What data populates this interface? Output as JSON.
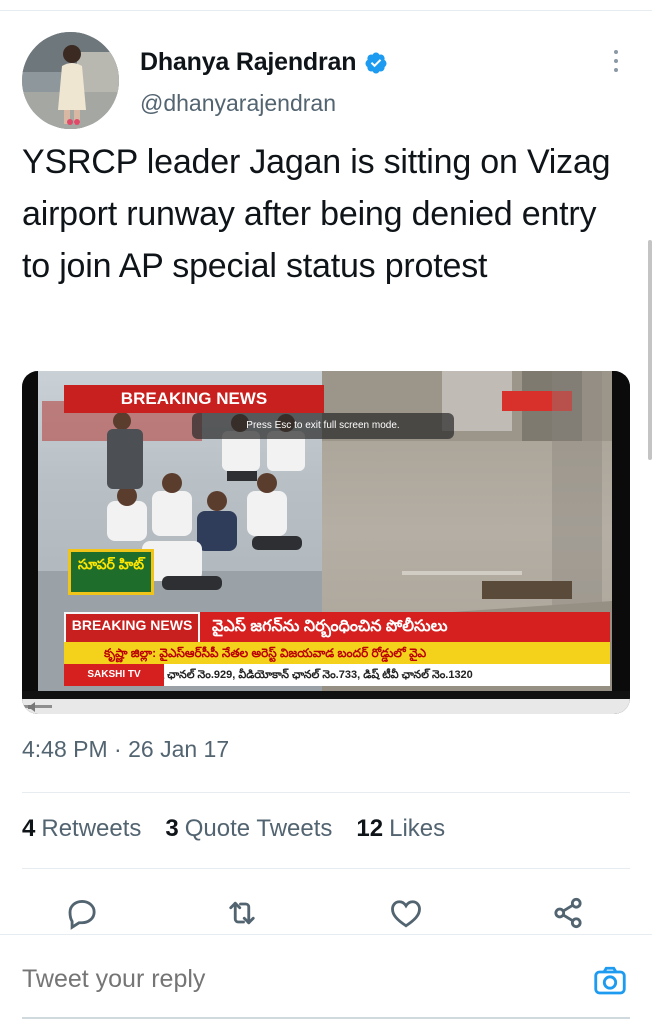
{
  "author": {
    "name": "Dhanya Rajendran",
    "handle": "@dhanyarajendran",
    "verified": true
  },
  "tweet": {
    "text": "YSRCP leader Jagan is sitting on Vizag airport runway after being denied entry to join AP special status protest",
    "timestamp": "4:48 PM · 26 Jan 17"
  },
  "media": {
    "breaking_top": "BREAKING NEWS",
    "esc_message": "Press Esc to exit full screen mode.",
    "super_hit": "సూపర్ హిట్",
    "breaking_bottom": "BREAKING NEWS",
    "ticker_headline": "వైఎస్ జగన్‌ను నిర్బంధించిన పోలీసులు",
    "ticker_yellow": "కృష్ణా జిల్లా: వైఎస్ఆర్‌సీపీ నేతల అరెస్ట్    విజయవాడ బందర్ రోడ్డులో వైఎ",
    "channel": "SAKSHI TV",
    "ticker_white": "టాటా స్కై ఛానల్ నెం.929, వీడియోకాన్ ఛానల్ నెం.733, డిష్ టీవీ ఛానల్ నెం.1320",
    "progress_fraction": 0.05
  },
  "stats": {
    "retweets_count": "4",
    "retweets_label": "Retweets",
    "quotes_count": "3",
    "quotes_label": "Quote Tweets",
    "likes_count": "12",
    "likes_label": "Likes"
  },
  "actions": [
    "reply-icon",
    "retweet-icon",
    "like-icon",
    "share-icon"
  ],
  "reply": {
    "placeholder": "Tweet your reply"
  },
  "colors": {
    "verified": "#1d9bf0",
    "secondary_text": "#536471",
    "primary_text": "#0f1419",
    "accent": "#1d9bf0"
  }
}
